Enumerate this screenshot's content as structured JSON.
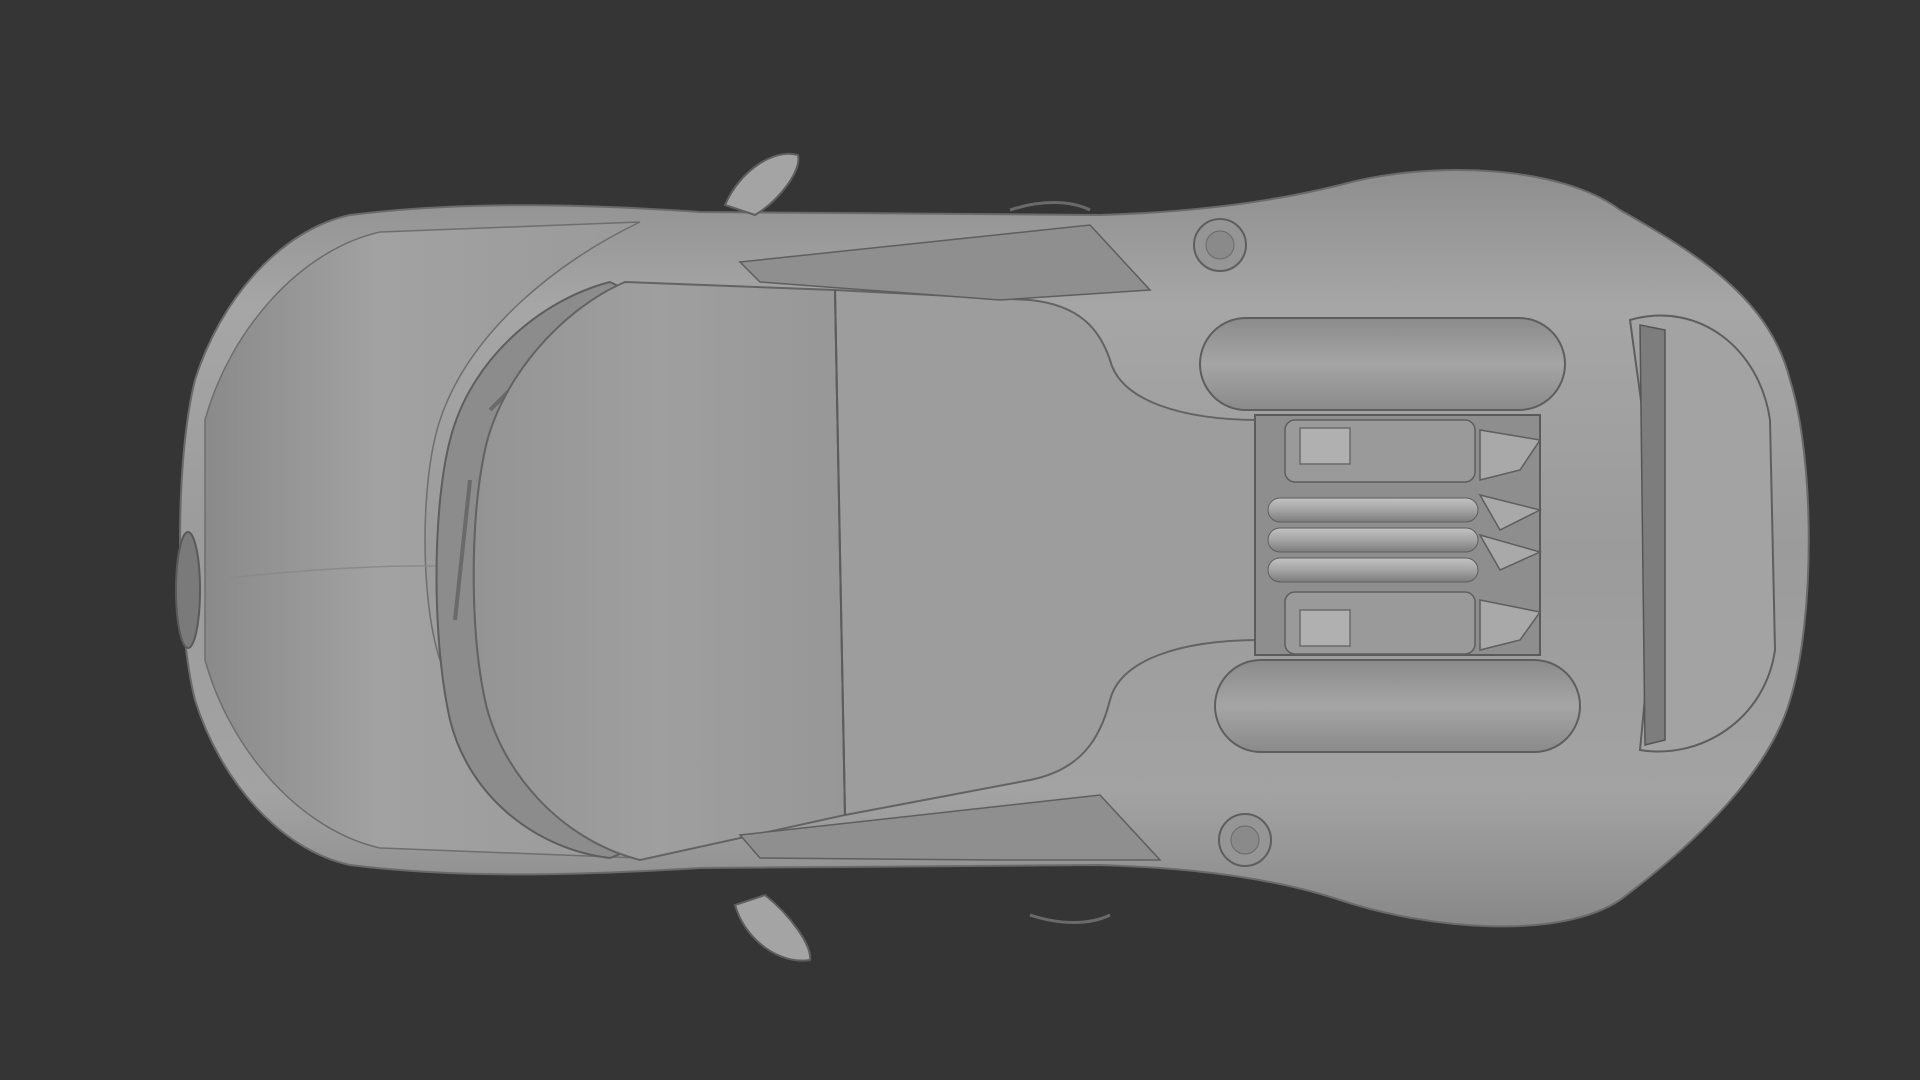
{
  "viewport": {
    "background_color": "#353535",
    "subject": "car-clay-render-top-view",
    "shading": "matcap-clay",
    "colors": {
      "body": "#9c9c9c",
      "body_light": "#a9a9a9",
      "body_dark": "#858585",
      "panel_line": "#5e5e5e",
      "engine_dark": "#6f6f6f",
      "engine_light": "#b3b3b3"
    }
  }
}
